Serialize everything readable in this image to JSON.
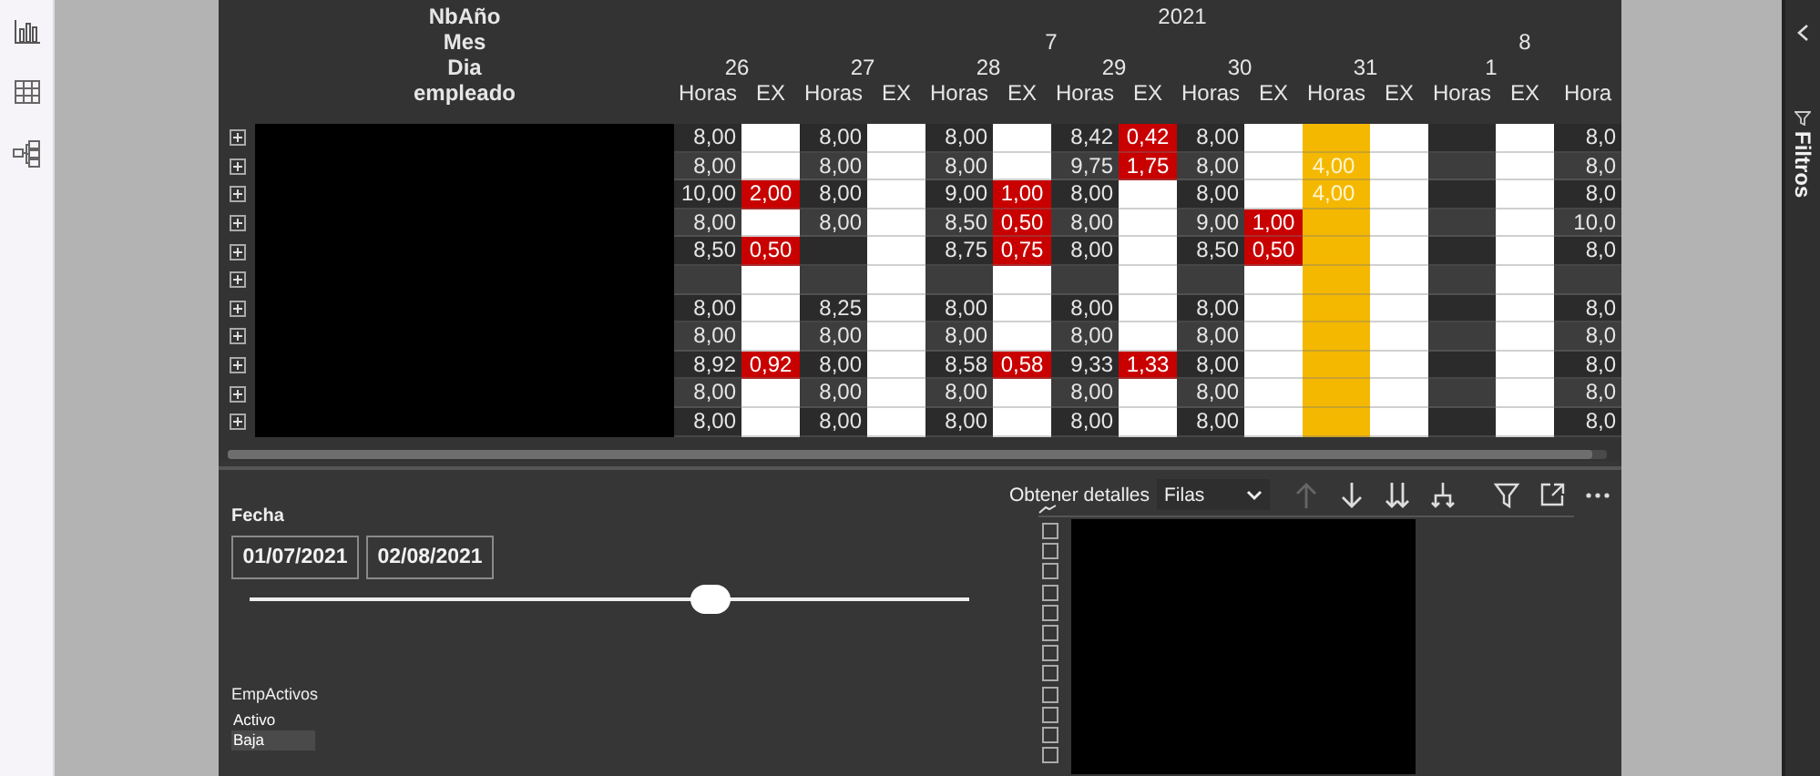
{
  "matrix": {
    "header_labels": [
      "NbAño",
      "Mes",
      "Dia",
      "empleado"
    ],
    "year": "2021",
    "months": [
      {
        "label": "7",
        "days": [
          {
            "label": "26",
            "highlight": false,
            "measures": [
              "Horas",
              "EX"
            ]
          },
          {
            "label": "27",
            "highlight": false,
            "measures": [
              "Horas",
              "EX"
            ]
          },
          {
            "label": "28",
            "highlight": false,
            "measures": [
              "Horas",
              "EX"
            ]
          },
          {
            "label": "29",
            "highlight": false,
            "measures": [
              "Horas",
              "EX"
            ]
          },
          {
            "label": "30",
            "highlight": false,
            "measures": [
              "Horas",
              "EX"
            ]
          },
          {
            "label": "31",
            "highlight": true,
            "measures": [
              "Horas",
              "EX"
            ]
          }
        ]
      },
      {
        "label": "8",
        "days": [
          {
            "label": "1",
            "highlight": false,
            "measures": [
              "Horas",
              "EX"
            ]
          },
          {
            "highlight": false,
            "measures": [
              "Hora"
            ]
          }
        ]
      }
    ],
    "rows": [
      {
        "expanded": false,
        "cells": [
          {
            "horas": "8,00"
          },
          {
            "horas": "8,00"
          },
          {
            "horas": "8,00"
          },
          {
            "horas": "8,42",
            "ex": "0,42"
          },
          {
            "horas": "8,00"
          },
          {},
          {},
          {
            "horas": "8,0"
          }
        ]
      },
      {
        "expanded": false,
        "cells": [
          {
            "horas": "8,00"
          },
          {
            "horas": "8,00"
          },
          {
            "horas": "8,00"
          },
          {
            "horas": "9,75",
            "ex": "1,75"
          },
          {
            "horas": "8,00"
          },
          {
            "horas": "4,00"
          },
          {},
          {
            "horas": "8,0"
          }
        ]
      },
      {
        "expanded": false,
        "cells": [
          {
            "horas": "10,00",
            "ex": "2,00"
          },
          {
            "horas": "8,00"
          },
          {
            "horas": "9,00",
            "ex": "1,00"
          },
          {
            "horas": "8,00"
          },
          {
            "horas": "8,00"
          },
          {
            "horas": "4,00"
          },
          {},
          {
            "horas": "8,0"
          }
        ]
      },
      {
        "expanded": false,
        "cells": [
          {
            "horas": "8,00"
          },
          {
            "horas": "8,00"
          },
          {
            "horas": "8,50",
            "ex": "0,50"
          },
          {
            "horas": "8,00"
          },
          {
            "horas": "9,00",
            "ex": "1,00"
          },
          {},
          {},
          {
            "horas": "10,0"
          }
        ]
      },
      {
        "expanded": false,
        "cells": [
          {
            "horas": "8,50",
            "ex": "0,50"
          },
          {},
          {
            "horas": "8,75",
            "ex": "0,75"
          },
          {
            "horas": "8,00"
          },
          {
            "horas": "8,50",
            "ex": "0,50"
          },
          {},
          {},
          {
            "horas": "8,0"
          }
        ]
      },
      {
        "expanded": false,
        "cells": [
          {},
          {},
          {},
          {},
          {},
          {},
          {},
          {}
        ]
      },
      {
        "expanded": false,
        "cells": [
          {
            "horas": "8,00"
          },
          {
            "horas": "8,25"
          },
          {
            "horas": "8,00"
          },
          {
            "horas": "8,00"
          },
          {
            "horas": "8,00"
          },
          {},
          {},
          {
            "horas": "8,0"
          }
        ]
      },
      {
        "expanded": false,
        "cells": [
          {
            "horas": "8,00"
          },
          {
            "horas": "8,00"
          },
          {
            "horas": "8,00"
          },
          {
            "horas": "8,00"
          },
          {
            "horas": "8,00"
          },
          {},
          {},
          {
            "horas": "8,0"
          }
        ]
      },
      {
        "expanded": false,
        "cells": [
          {
            "horas": "8,92",
            "ex": "0,92"
          },
          {
            "horas": "8,00"
          },
          {
            "horas": "8,58",
            "ex": "0,58"
          },
          {
            "horas": "9,33",
            "ex": "1,33"
          },
          {
            "horas": "8,00"
          },
          {},
          {},
          {
            "horas": "8,0"
          }
        ]
      },
      {
        "expanded": false,
        "cells": [
          {
            "horas": "8,00"
          },
          {
            "horas": "8,00"
          },
          {
            "horas": "8,00"
          },
          {
            "horas": "8,00"
          },
          {
            "horas": "8,00"
          },
          {},
          {},
          {
            "horas": "8,0"
          }
        ]
      },
      {
        "expanded": false,
        "cells": [
          {
            "horas": "8,00"
          },
          {
            "horas": "8,00"
          },
          {
            "horas": "8,00"
          },
          {
            "horas": "8,00"
          },
          {
            "horas": "8,00"
          },
          {},
          {},
          {
            "horas": "8,0"
          }
        ]
      }
    ]
  },
  "date_slicer": {
    "title": "Fecha",
    "start": "01/07/2021",
    "end": "02/08/2021",
    "level": 0.64
  },
  "list_slicer": {
    "title": "EmpActivos",
    "items": [
      {
        "label": "Activo",
        "selected": false
      },
      {
        "label": "Baja",
        "selected": true
      }
    ]
  },
  "details": {
    "label": "Obtener detalles",
    "mode": "Filas",
    "toolbar": [
      {
        "kind": "up",
        "disabled": true
      },
      {
        "kind": "down",
        "disabled": false
      },
      {
        "kind": "down-all",
        "disabled": false
      },
      {
        "kind": "expand-down",
        "disabled": false
      },
      {
        "kind": "filter",
        "disabled": false
      },
      {
        "kind": "focus",
        "disabled": false
      },
      {
        "kind": "more",
        "disabled": false
      }
    ],
    "checkboxes": [
      {
        "checked": false
      },
      {
        "checked": false
      },
      {
        "checked": false
      },
      {
        "checked": false
      },
      {
        "checked": false
      },
      {
        "checked": false
      },
      {
        "checked": false
      },
      {
        "checked": false
      },
      {
        "checked": false
      },
      {
        "checked": false
      },
      {
        "checked": false
      },
      {
        "checked": false
      }
    ]
  },
  "filters_pane": {
    "title": "Filtros"
  }
}
